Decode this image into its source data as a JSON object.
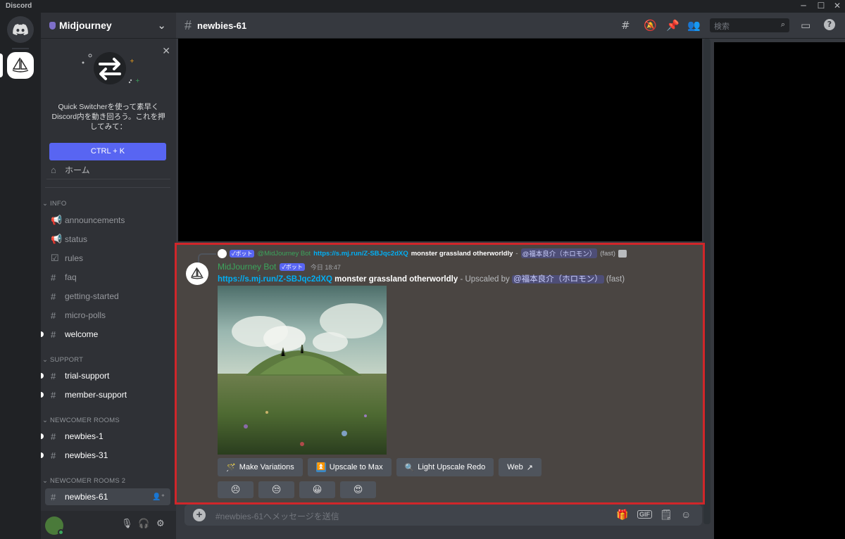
{
  "window": {
    "app_name": "Discord",
    "minimize": "─",
    "maximize": "☐",
    "close": "✕"
  },
  "server": {
    "name": "Midjourney",
    "chevron": "⌄"
  },
  "quick_switcher": {
    "text": "Quick Switcherを使って素早くDiscord内を動き回ろう。これを押してみて：",
    "button": "CTRL + K",
    "close": "✕"
  },
  "nav": {
    "home": "ホーム",
    "categories": {
      "info": "INFO",
      "support": "SUPPORT",
      "newcomer": "NEWCOMER ROOMS",
      "newcomer2": "NEWCOMER ROOMS 2"
    },
    "channels": {
      "announcements": "announcements",
      "status": "status",
      "rules": "rules",
      "faq": "faq",
      "getting_started": "getting-started",
      "micro_polls": "micro-polls",
      "welcome": "welcome",
      "trial_support": "trial-support",
      "member_support": "member-support",
      "newbies_1": "newbies-1",
      "newbies_31": "newbies-31",
      "newbies_61": "newbies-61"
    }
  },
  "header": {
    "channel": "newbies-61",
    "search_placeholder": "検索"
  },
  "message": {
    "reply": {
      "badge": "✓ボット",
      "author": "@MidJourney Bot",
      "link": "https://s.mj.run/Z-SBJqc2dXQ",
      "prompt": "monster grassland otherworldly",
      "sep": " - ",
      "mention": "@福本良介（ホロモン）",
      "mode": "(fast)"
    },
    "author": "MidJourney Bot",
    "badge": "✓ボット",
    "timestamp": "今日 18:47",
    "link": "https://s.mj.run/Z-SBJqc2dXQ",
    "prompt": "monster grassland otherworldly",
    "upscaled_by": " - Upscaled by ",
    "mention": "@福本良介（ホロモン）",
    "mode": "(fast)",
    "buttons": {
      "make_variations": "Make Variations",
      "upscale_max": "Upscale to Max",
      "light_upscale": "Light Upscale Redo",
      "web": "Web"
    },
    "reactions": [
      "😣",
      "😒",
      "😀",
      "😍"
    ]
  },
  "composer": {
    "placeholder": "#newbies-61へメッセージを送信"
  }
}
